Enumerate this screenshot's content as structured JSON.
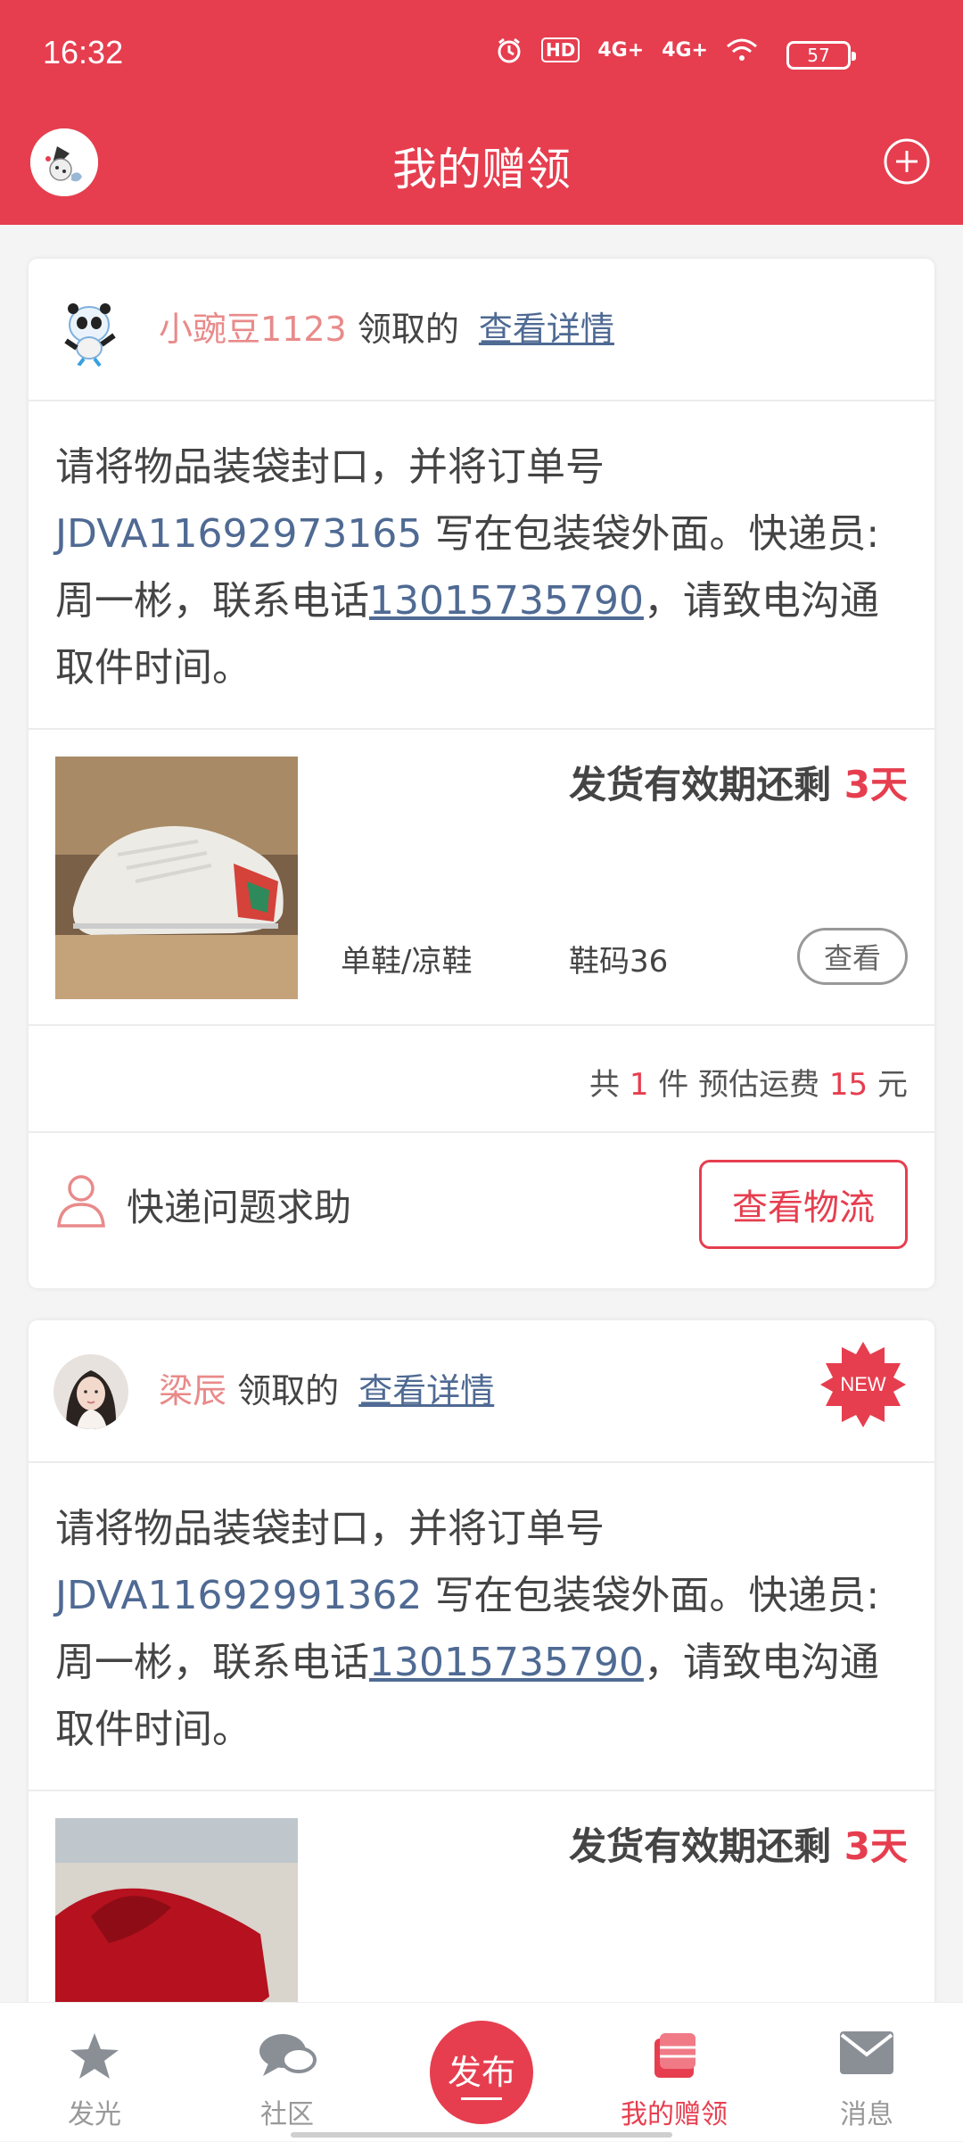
{
  "status_bar": {
    "time": "16:32",
    "network_labels": [
      "HD",
      "4G+",
      "4G+"
    ],
    "battery": "57"
  },
  "navbar": {
    "title": "我的赠领",
    "add_icon": "plus-circle-icon"
  },
  "cards": [
    {
      "username": "小豌豆1123",
      "claimed_text": "领取的",
      "detail_link": "查看详情",
      "note_part1": "请将物品装袋封口，并将订单号 ",
      "order_no": "JDVA11692973165",
      "note_part2": " 写在包装袋外面。快递员:周一彬，联系电话",
      "phone": "13015735790",
      "note_part3": "，请致电沟通取件时间。",
      "deadline_prefix": "发货有效期还剩 ",
      "deadline_days": "3天",
      "category": "单鞋/凉鞋",
      "size": "鞋码36",
      "view_label": "查看",
      "summary_total_prefix": "共 ",
      "summary_count": "1",
      "summary_mid": " 件 预估运费 ",
      "summary_fee": "15",
      "summary_unit": " 元",
      "help_label": "快递问题求助",
      "logistics_label": "查看物流"
    },
    {
      "username": "梁辰",
      "claimed_text": "领取的",
      "detail_link": "查看详情",
      "new_badge": "NEW",
      "note_part1": "请将物品装袋封口，并将订单号 ",
      "order_no": "JDVA11692991362",
      "note_part2": " 写在包装袋外面。快递员:周一彬，联系电话",
      "phone": "13015735790",
      "note_part3": "，请致电沟通取件时间。",
      "deadline_prefix": "发货有效期还剩 ",
      "deadline_days": "3天"
    }
  ],
  "tabbar": {
    "tabs": [
      {
        "label": "发光",
        "icon": "star-icon"
      },
      {
        "label": "社区",
        "icon": "chat-bubbles-icon"
      },
      {
        "label": "发布",
        "icon": "publish-button"
      },
      {
        "label": "我的赠领",
        "icon": "gift-box-icon",
        "active": true
      },
      {
        "label": "消息",
        "icon": "envelope-icon"
      }
    ]
  },
  "colors": {
    "brand_red": "#e63e4f",
    "link_blue": "#4f6a93",
    "username_pink": "#e98a8a"
  }
}
